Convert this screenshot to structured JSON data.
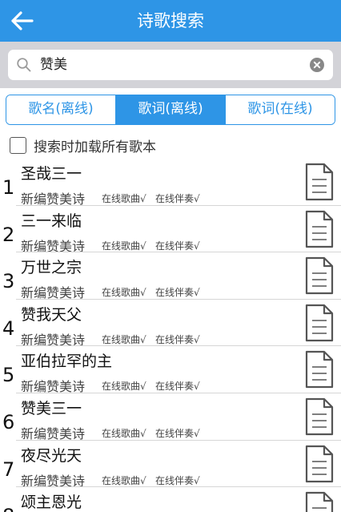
{
  "header": {
    "title": "诗歌搜索",
    "back_icon": "arrow-left-icon"
  },
  "search": {
    "value": "赞美",
    "search_icon": "search-icon",
    "clear_icon": "clear-icon"
  },
  "tabs": [
    {
      "label": "歌名(离线)",
      "active": false
    },
    {
      "label": "歌词(离线)",
      "active": true
    },
    {
      "label": "歌词(在线)",
      "active": false
    }
  ],
  "option": {
    "label": "搜索时加载所有歌本",
    "checked": false
  },
  "results": [
    {
      "num": "1",
      "title": "圣哉三一",
      "book": "新编赞美诗",
      "tag1": "在线歌曲√",
      "tag2": "在线伴奏√"
    },
    {
      "num": "2",
      "title": "三一来临",
      "book": "新编赞美诗",
      "tag1": "在线歌曲√",
      "tag2": "在线伴奏√"
    },
    {
      "num": "3",
      "title": "万世之宗",
      "book": "新编赞美诗",
      "tag1": "在线歌曲√",
      "tag2": "在线伴奏√"
    },
    {
      "num": "4",
      "title": "赞我天父",
      "book": "新编赞美诗",
      "tag1": "在线歌曲√",
      "tag2": "在线伴奏√"
    },
    {
      "num": "5",
      "title": "亚伯拉罕的主",
      "book": "新编赞美诗",
      "tag1": "在线歌曲√",
      "tag2": "在线伴奏√"
    },
    {
      "num": "6",
      "title": "赞美三一",
      "book": "新编赞美诗",
      "tag1": "在线歌曲√",
      "tag2": "在线伴奏√"
    },
    {
      "num": "7",
      "title": "夜尽光天",
      "book": "新编赞美诗",
      "tag1": "在线歌曲√",
      "tag2": "在线伴奏√"
    },
    {
      "num": "8",
      "title": "颂主恩光",
      "book": "",
      "tag1": "",
      "tag2": ""
    }
  ],
  "row_icon": "document-icon",
  "colors": {
    "primary": "#2e95e6",
    "search_bg": "#d3d3d8",
    "divider": "#d6d6d6"
  }
}
